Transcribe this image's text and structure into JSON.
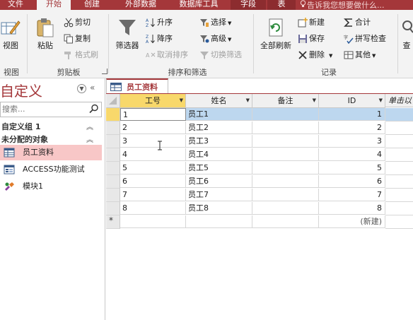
{
  "tabs": [
    {
      "label": "文件",
      "active": false,
      "contextual": false
    },
    {
      "label": "开始",
      "active": true,
      "contextual": false
    },
    {
      "label": "创建",
      "active": false,
      "contextual": false
    },
    {
      "label": "外部数据",
      "active": false,
      "contextual": false
    },
    {
      "label": "数据库工具",
      "active": false,
      "contextual": false
    },
    {
      "label": "字段",
      "active": false,
      "contextual": true
    },
    {
      "label": "表",
      "active": false,
      "contextual": true
    }
  ],
  "tellme": "告诉我您想要做什么...",
  "ribbon": {
    "view": {
      "label": "视图",
      "group": "视图"
    },
    "clipboard": {
      "paste": "粘贴",
      "cut": "剪切",
      "copy": "复制",
      "format_painter": "格式刷",
      "group": "剪贴板"
    },
    "sort": {
      "filter": "筛选器",
      "asc": "升序",
      "desc": "降序",
      "remove_sort": "取消排序",
      "select": "选择",
      "advanced": "高级",
      "toggle_filter": "切换筛选",
      "group": "排序和筛选"
    },
    "records": {
      "refresh": "全部刷新",
      "new": "新建",
      "save": "保存",
      "delete": "删除",
      "total": "合计",
      "spell": "拼写检查",
      "other": "其他",
      "group": "记录"
    },
    "find": {
      "label": "查"
    }
  },
  "nav": {
    "title": "自定义",
    "search_placeholder": "搜索...",
    "groups": [
      {
        "label": "自定义组 1"
      },
      {
        "label": "未分配的对象"
      }
    ],
    "items": [
      {
        "label": "员工资料",
        "selected": true
      },
      {
        "label": "ACCESS功能测试",
        "selected": false
      },
      {
        "label": "模块1",
        "selected": false
      }
    ]
  },
  "document": {
    "tab_label": "员工资料",
    "columns": [
      "工号",
      "姓名",
      "备注",
      "ID",
      "单击以"
    ],
    "rows": [
      {
        "gonghao": "1",
        "name": "员工1",
        "note": "",
        "id": "1"
      },
      {
        "gonghao": "2",
        "name": "员工2",
        "note": "",
        "id": "2"
      },
      {
        "gonghao": "3",
        "name": "员工3",
        "note": "",
        "id": "3"
      },
      {
        "gonghao": "4",
        "name": "员工4",
        "note": "",
        "id": "4"
      },
      {
        "gonghao": "5",
        "name": "员工5",
        "note": "",
        "id": "5"
      },
      {
        "gonghao": "6",
        "name": "员工6",
        "note": "",
        "id": "6"
      },
      {
        "gonghao": "7",
        "name": "员工7",
        "note": "",
        "id": "7"
      },
      {
        "gonghao": "8",
        "name": "员工8",
        "note": "",
        "id": "8"
      }
    ],
    "new_row_marker": "*",
    "new_row_label": "(新建)"
  },
  "colors": {
    "accent": "#a4373a",
    "selected_row": "#bdd7ef",
    "header_selected": "#f8d86b",
    "nav_selected": "#f8c7c7"
  }
}
